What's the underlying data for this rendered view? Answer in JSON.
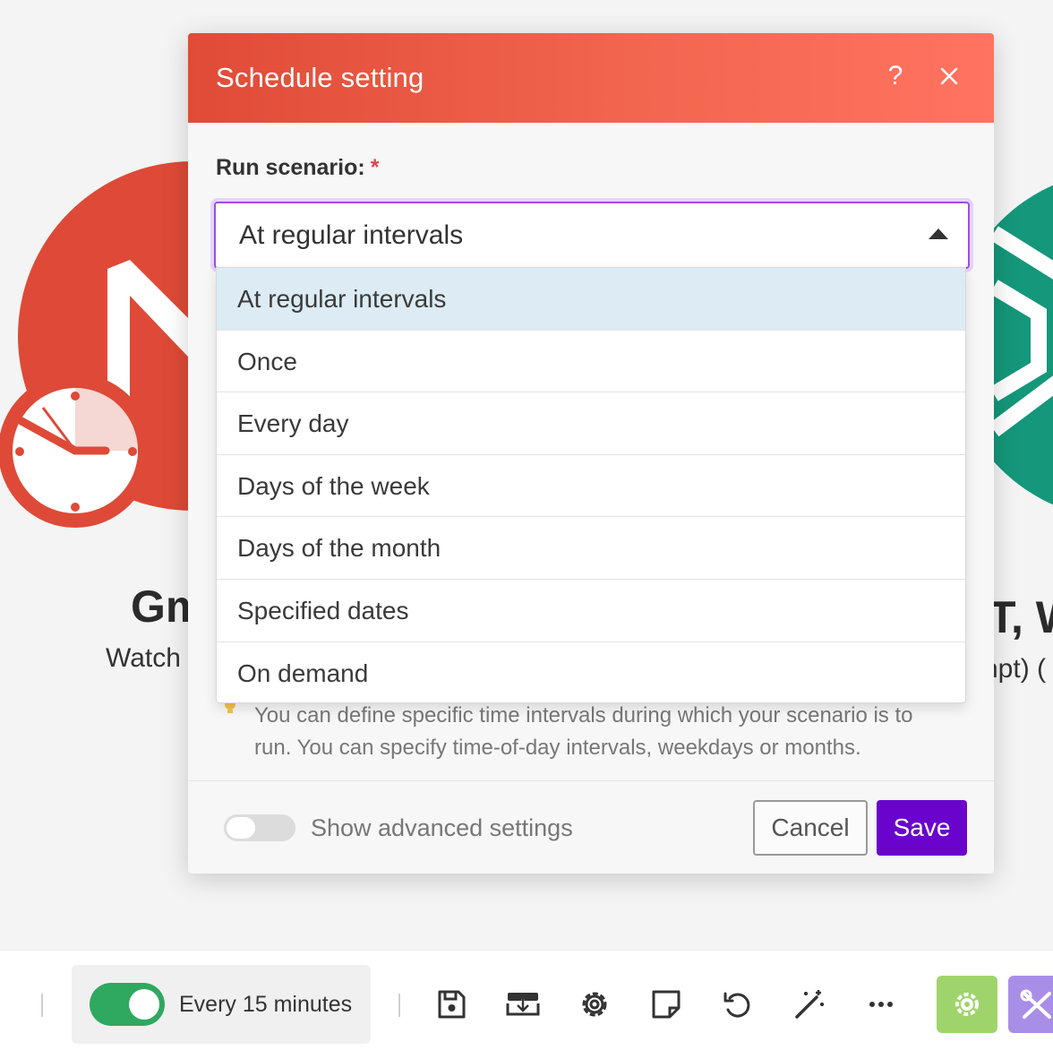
{
  "background": {
    "left_module_title": "Gm",
    "left_module_subtitle": "Watch",
    "right_module_title": "T, W",
    "right_module_subtitle": "npt) (",
    "left_module_icon": "gmail-icon",
    "right_module_icon": "openai-icon",
    "clock_icon": "clock-icon",
    "colors": {
      "gmail": "#de4a37",
      "openai": "#14977a"
    }
  },
  "dialog": {
    "title": "Schedule setting",
    "help_label": "?",
    "field_label": "Run scenario:",
    "required_mark": "*",
    "select_value": "At regular intervals",
    "options": [
      "At regular intervals",
      "Once",
      "Every day",
      "Days of the week",
      "Days of the month",
      "Specified dates",
      "On demand"
    ],
    "selected_option": "At regular intervals",
    "help_text_line1": "You can define specific time intervals during which your scenario is to",
    "help_text_line2": "run. You can specify time-of-day intervals, weekdays or months.",
    "advanced_toggle_label": "Show advanced settings",
    "advanced_toggle_on": false,
    "cancel_label": "Cancel",
    "save_label": "Save",
    "colors": {
      "header_start": "#e04b37",
      "header_end": "#ff7360",
      "save_bg": "#6a04cc",
      "focus_ring": "#9c4ee5"
    }
  },
  "toolbar": {
    "schedule_toggle_on": true,
    "schedule_label": "Every 15 minutes",
    "icons": [
      "save-icon",
      "export-blueprint-icon",
      "settings-gear-icon",
      "notes-icon",
      "undo-icon",
      "magic-wand-icon",
      "more-icon",
      "gear-icon",
      "tools-icon"
    ],
    "colors": {
      "toggle_on": "#2fa860",
      "green_button": "#9fd46c",
      "purple_button": "#a98ee8"
    }
  }
}
